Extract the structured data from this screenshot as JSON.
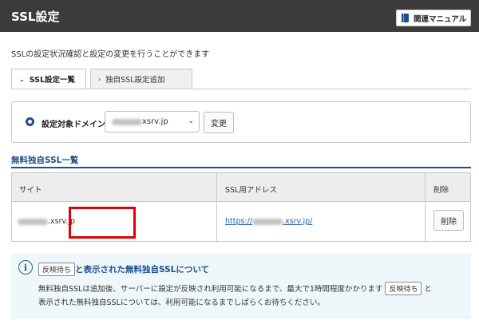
{
  "header": {
    "title": "SSL設定",
    "manual_label": "関連マニュアル"
  },
  "description": "SSLの設定状況確認と設定の変更を行うことができます",
  "tabs": [
    {
      "label": "SSL設定一覧",
      "active": true
    },
    {
      "label": "独自SSL設定追加",
      "active": false
    }
  ],
  "domain_form": {
    "label": "設定対象ドメイン",
    "selected_value": "xsrv.jp",
    "change_button": "変更"
  },
  "section_title": "無料独自SSL一覧",
  "table": {
    "columns": [
      "サイト",
      "SSL用アドレス",
      "削除"
    ],
    "rows": [
      {
        "site": ".xsrv.jp",
        "url_prefix": "https://",
        "url_suffix": ".xsrv.jp/",
        "delete_label": "削除"
      }
    ]
  },
  "info": {
    "badge": "反映待ち",
    "title_suffix": "と表示された無料独自SSLについて",
    "line1_before": "無料独自SSLは追加後、サーバーに設定が反映され利用可能になるまで、最大で1時間程度かかります",
    "line1_badge": "反映待ち",
    "line1_after": "と",
    "line2": "表示された無料独自SSLについては、利用可能になるまでしばらくお待ちください。"
  },
  "colors": {
    "header_bg": "#3b3b3b",
    "accent": "#1f4e8c",
    "link": "#1f5fae",
    "highlight": "#e00000",
    "info_bg": "#eef7fa"
  }
}
